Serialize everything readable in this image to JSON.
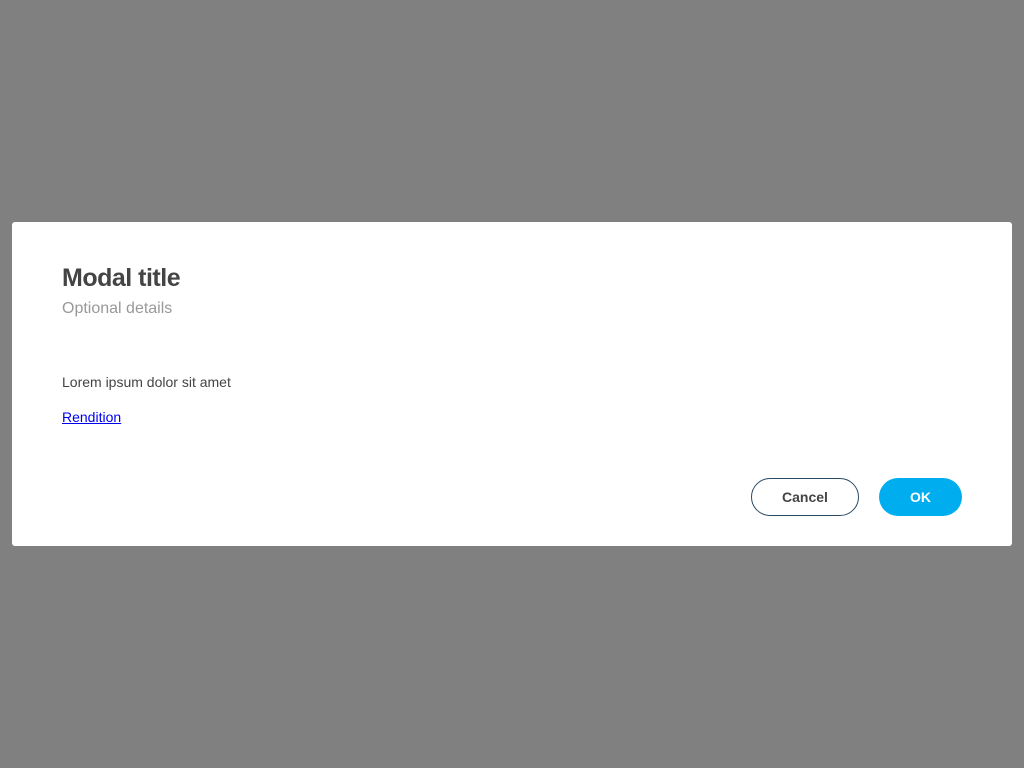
{
  "modal": {
    "title": "Modal title",
    "subtitle": "Optional details",
    "body": "Lorem ipsum dolor sit amet",
    "link": "Rendition",
    "cancel_label": "Cancel",
    "ok_label": "OK"
  },
  "colors": {
    "overlay": "#808080",
    "primary": "#00aeef",
    "link": "#0000ee"
  }
}
